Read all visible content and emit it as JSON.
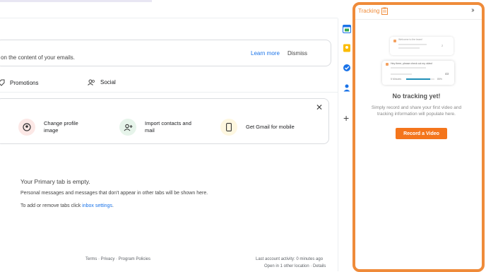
{
  "banner": {
    "text": "on the content of your emails.",
    "learn_more": "Learn more",
    "dismiss": "Dismiss"
  },
  "tabs": [
    {
      "label": "Promotions",
      "icon": "tag-icon"
    },
    {
      "label": "Social",
      "icon": "people-icon"
    }
  ],
  "setup": {
    "items": [
      {
        "label": "Change profile image",
        "icon": "account-icon",
        "color": "#fce8e6"
      },
      {
        "label": "Import contacts and mail",
        "icon": "add-person-icon",
        "color": "#e6f4ea"
      },
      {
        "label": "Get Gmail for mobile",
        "icon": "phone-icon",
        "color": "#fef7e0"
      }
    ]
  },
  "empty": {
    "title": "Your Primary tab is empty.",
    "line1": "Personal messages and messages that don't appear in other tabs will be shown here.",
    "line2_prefix": "To add or remove tabs click ",
    "line2_link": "inbox settings",
    "line2_suffix": "."
  },
  "footer": {
    "links": "Terms · Privacy · Program Policies",
    "activity": "Last account activity: 0 minutes ago",
    "other_location": "Open in 1 other location · Details"
  },
  "tracking": {
    "title": "Tracking",
    "no_tracking_title": "No tracking yet!",
    "no_tracking_desc": "Simply record and share your first video and tracking information will populate here.",
    "record_button": "Record a Video",
    "illustration": {
      "card1_text": "Welcome to the team!",
      "card1_count": "2",
      "card2_text": "Hey there, please check out my video!",
      "card2_minutes": "5 Minutes",
      "card2_percent": "85%",
      "card2_count": "43"
    }
  },
  "colors": {
    "accent": "#ef8b3a",
    "button": "#f4751c",
    "link": "#1a73e8"
  }
}
